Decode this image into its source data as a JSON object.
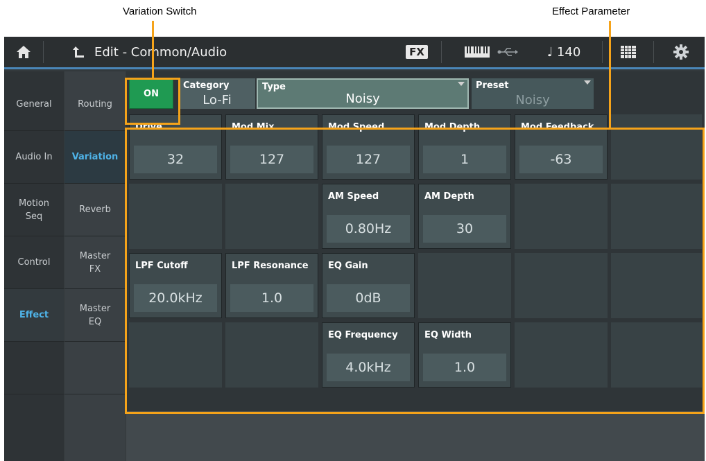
{
  "callouts": {
    "variation_switch": "Variation Switch",
    "effect_parameter": "Effect Parameter"
  },
  "topbar": {
    "title": "Edit - Common/Audio",
    "fx_badge": "FX",
    "tempo": "♩ 140",
    "icons": [
      "home-icon",
      "back-icon",
      "keyboard-icon",
      "usb-icon",
      "grid-icon",
      "gear-icon"
    ]
  },
  "nav_col1": [
    {
      "label": "General",
      "active": false
    },
    {
      "label": "Audio In",
      "active": false
    },
    {
      "label": "Motion\nSeq",
      "active": false
    },
    {
      "label": "Control",
      "active": false
    },
    {
      "label": "Effect",
      "active": true
    }
  ],
  "nav_col2": [
    {
      "label": "Routing",
      "active": false
    },
    {
      "label": "Variation",
      "active": true
    },
    {
      "label": "Reverb",
      "active": false
    },
    {
      "label": "Master\nFX",
      "active": false
    },
    {
      "label": "Master\nEQ",
      "active": false
    }
  ],
  "header": {
    "switch_label": "ON",
    "category_label": "Category",
    "category_value": "Lo-Fi",
    "type_label": "Type",
    "type_value": "Noisy",
    "preset_label": "Preset",
    "preset_value": "Noisy"
  },
  "params": [
    {
      "label": "Drive",
      "value": "32"
    },
    {
      "label": "Mod Mix",
      "value": "127"
    },
    {
      "label": "Mod Speed",
      "value": "127"
    },
    {
      "label": "Mod Depth",
      "value": "1"
    },
    {
      "label": "Mod Feedback",
      "value": "-63"
    },
    {
      "label": "AM Speed",
      "value": "0.80Hz"
    },
    {
      "label": "AM Depth",
      "value": "30"
    },
    {
      "label": "LPF Cutoff",
      "value": "20.0kHz"
    },
    {
      "label": "LPF Resonance",
      "value": "1.0"
    },
    {
      "label": "EQ Gain",
      "value": "0dB"
    },
    {
      "label": "EQ Frequency",
      "value": "4.0kHz"
    },
    {
      "label": "EQ Width",
      "value": "1.0"
    }
  ],
  "colors": {
    "accent": "#f5a31a",
    "on_button": "#1f9a52",
    "active_nav": "#4fb3e8"
  }
}
